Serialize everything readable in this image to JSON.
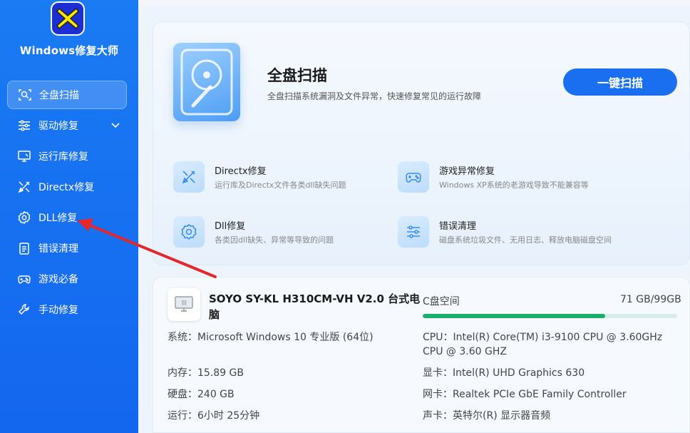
{
  "app": {
    "brand": "Windows修复大师",
    "logo_icon": "x-logo-icon"
  },
  "sidebar": {
    "items": [
      {
        "label": "全盘扫描",
        "icon": "scan-icon",
        "active": true
      },
      {
        "label": "驱动修复",
        "icon": "sliders-icon",
        "has_chevron": true
      },
      {
        "label": "运行库修复",
        "icon": "monitor-tool-icon"
      },
      {
        "label": "Directx修复",
        "icon": "wrench-pencil-icon"
      },
      {
        "label": "DLL修复",
        "icon": "gear-icon"
      },
      {
        "label": "错误清理",
        "icon": "clipboard-icon"
      },
      {
        "label": "游戏必备",
        "icon": "gamepad-icon"
      },
      {
        "label": "手动修复",
        "icon": "wrench-icon"
      }
    ]
  },
  "hero": {
    "title": "全盘扫描",
    "description": "全盘扫描系统漏洞及文件异常，快速修复常见的运行故障",
    "button": "一键扫描"
  },
  "features": [
    {
      "title": "Directx修复",
      "desc": "运行库及Directx文件各类dll缺失问题",
      "icon": "wrench-pencil-icon"
    },
    {
      "title": "游戏异常修复",
      "desc": "Windows XP系统的老游戏导致不能兼容等",
      "icon": "gamepad-icon"
    },
    {
      "title": "Dll修复",
      "desc": "各类因dll缺失、异常等导致的问题",
      "icon": "gear-icon"
    },
    {
      "title": "错误清理",
      "desc": "磁盘系统垃圾文件、无用日志、释放电脑磁盘空间",
      "icon": "sliders-icon"
    }
  ],
  "system": {
    "pc_name": "SOYO SY-KL H310CM-VH V2.0 台式电脑",
    "os": "系统：Microsoft Windows 10 专业版 (64位)",
    "memory": "内存：15.89 GB",
    "disk": "硬盘：240 GB",
    "uptime": "运行：6小时 25分钟",
    "cpu": "CPU：Intel(R) Core(TM) i3-9100 CPU @ 3.60GHz CPU @ 3.60 GHZ",
    "gpu": "显卡：Intel(R) UHD Graphics 630",
    "nic": "网卡：Realtek PCIe GbE Family Controller",
    "sound": "声卡：英特尔(R) 显示器音频",
    "c_drive_label": "C盘空间",
    "c_drive_value": "71 GB/99GB",
    "c_drive_used_fraction": 0.717
  },
  "colors": {
    "sidebar": "#1a7bf3",
    "accent": "#1a6ff0",
    "progress": "#1aaf6a",
    "annotation_arrow": "#e5262a"
  }
}
